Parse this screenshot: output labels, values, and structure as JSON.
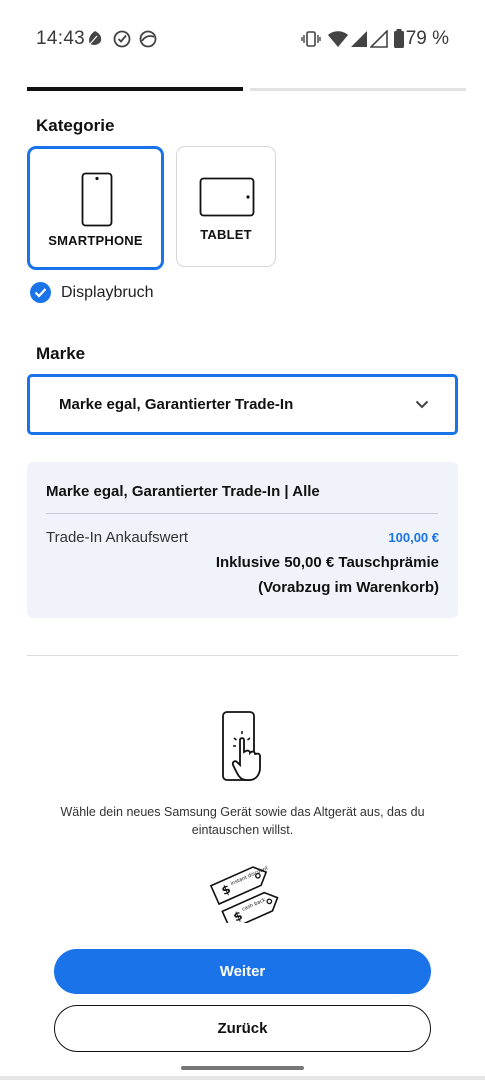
{
  "status_bar": {
    "time": "14:43",
    "battery_text": "79 %",
    "left_icons": [
      "leaf-icon",
      "check-circle-icon",
      "browser-icon"
    ],
    "right_icons": [
      "vibrate-icon",
      "wifi-icon",
      "signal-icon",
      "signal-icon",
      "battery-icon"
    ]
  },
  "progress": {
    "active_step": 1,
    "total_steps": 2
  },
  "category": {
    "title": "Kategorie",
    "options": [
      {
        "label": "SMARTPHONE",
        "selected": true,
        "icon": "smartphone-icon"
      },
      {
        "label": "TABLET",
        "selected": false,
        "icon": "tablet-icon"
      }
    ],
    "checkbox": {
      "label": "Displaybruch",
      "checked": true
    }
  },
  "brand": {
    "title": "Marke",
    "selected": "Marke egal, Garantierter Trade-In"
  },
  "summary": {
    "title": "Marke egal, Garantierter Trade-In | Alle",
    "row_label": "Trade-In Ankaufswert",
    "row_value": "100,00 €",
    "bonus": "Inklusive 50,00 € Tauschprämie",
    "note": "(Vorabzug im Warenkorb)"
  },
  "instruction": {
    "text": "Wähle dein neues Samsung Gerät sowie das Altgerät aus, das du eintauschen willst.",
    "tag_text_1": "instant discount",
    "tag_text_2": "cash back"
  },
  "buttons": {
    "next": "Weiter",
    "back": "Zurück"
  },
  "colors": {
    "accent": "#1a73e8",
    "card_bg": "#f0f4fa"
  }
}
